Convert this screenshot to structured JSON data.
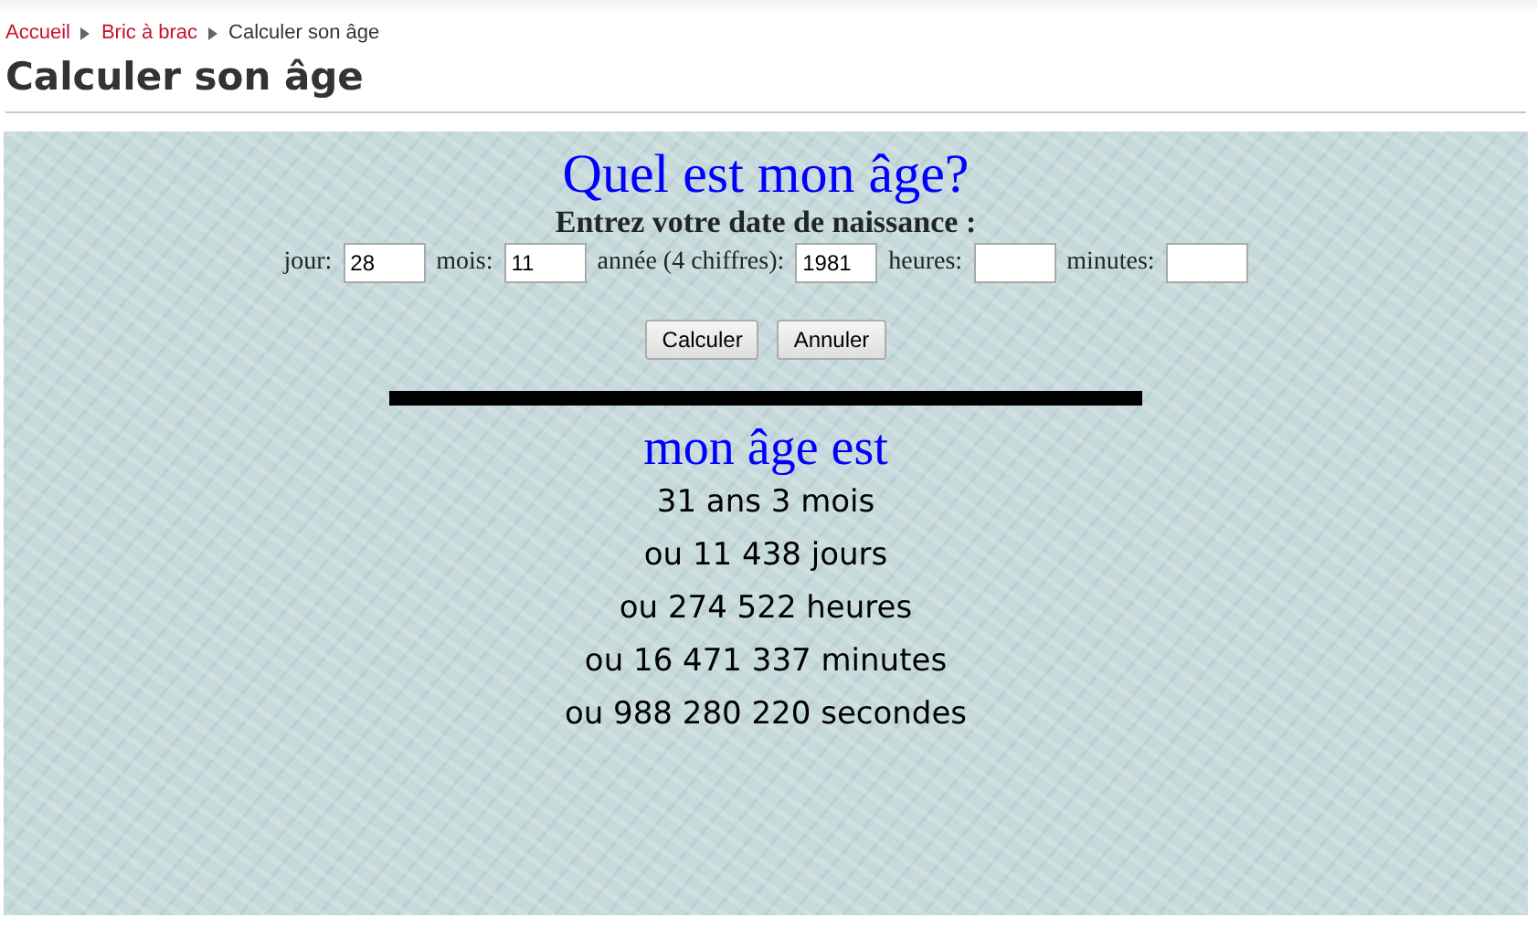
{
  "breadcrumb": [
    {
      "label": "Accueil",
      "kind": "link"
    },
    {
      "label": "Bric à brac",
      "kind": "link"
    },
    {
      "label": "Calculer son âge",
      "kind": "current"
    }
  ],
  "page_title": "Calculer son âge",
  "form": {
    "title": "Quel est mon âge?",
    "prompt": "Entrez votre date de naissance :",
    "fields": [
      {
        "label": "jour:",
        "value": "28"
      },
      {
        "label": "mois:",
        "value": "11"
      },
      {
        "label": "année (4 chiffres):",
        "value": "1981"
      },
      {
        "label": "heures:"
      },
      {
        "label": "minutes:"
      }
    ],
    "buttons": [
      "Calculer",
      "Annuler"
    ]
  },
  "result": {
    "title": "mon âge est",
    "lines": [
      "31 ans 3 mois",
      "ou 11 438 jours",
      "ou 274 522 heures",
      "ou 16 471 337 minutes",
      "ou 988 280 220 secondes"
    ]
  }
}
